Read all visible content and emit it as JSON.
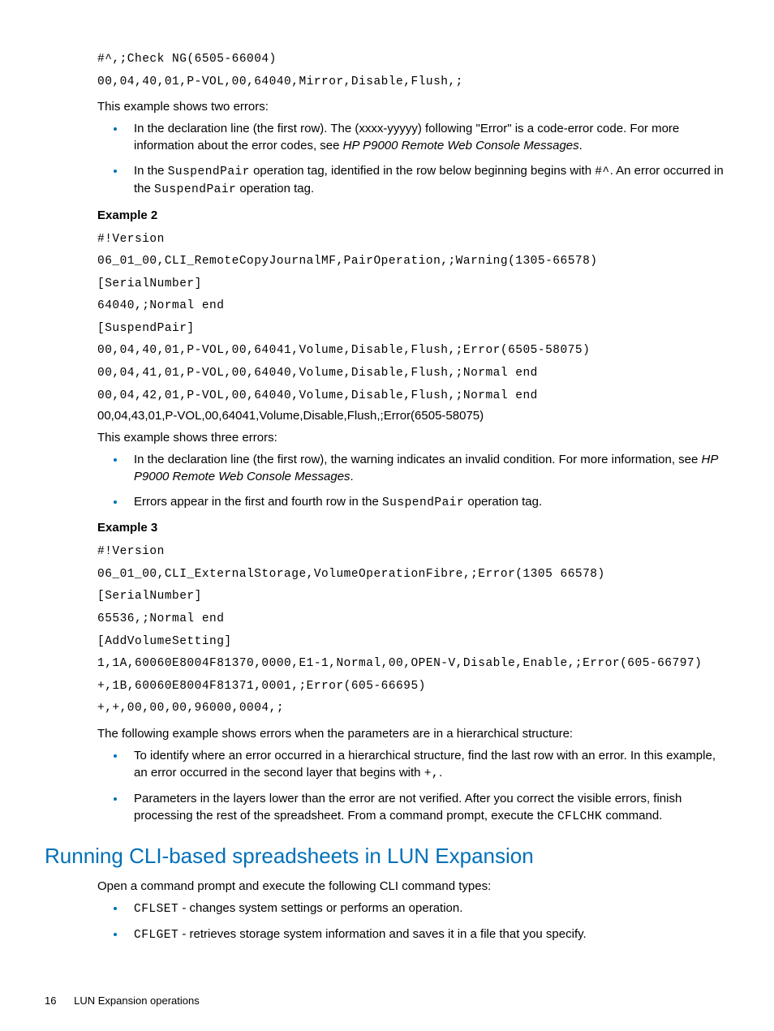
{
  "block1": {
    "lines": [
      "#^,;Check NG(6505-66004)",
      "00,04,40,01,P-VOL,00,64040,Mirror,Disable,Flush,;"
    ],
    "intro": "This example shows two errors:",
    "bullets": [
      {
        "pre": "In the declaration line (the first row). The (xxxx-yyyyy) following \"Error\" is a code-error code. For more information about the error codes, see ",
        "ital": "HP P9000 Remote Web Console Messages",
        "post": "."
      },
      {
        "pre1": "In the ",
        "code1": "SuspendPair",
        "mid1": " operation tag, identified in the row below beginning begins with ",
        "code2": "#^",
        "mid2": ". An error occurred in the ",
        "code3": "SuspendPair",
        "post": " operation tag."
      }
    ]
  },
  "example2": {
    "header": "Example 2",
    "lines": [
      "#!Version",
      "06_01_00,CLI_RemoteCopyJournalMF,PairOperation,;Warning(1305-66578)",
      "[SerialNumber]",
      "64040,;Normal end",
      "[SuspendPair]",
      "00,04,40,01,P-VOL,00,64041,Volume,Disable,Flush,;Error(6505-58075)",
      "00,04,41,01,P-VOL,00,64040,Volume,Disable,Flush,;Normal end",
      "00,04,42,01,P-VOL,00,64040,Volume,Disable,Flush,;Normal end"
    ],
    "sans_line": "00,04,43,01,P-VOL,00,64041,Volume,Disable,Flush,;Error(6505-58075)",
    "intro": "This example shows three errors:",
    "bullets": [
      {
        "pre": "In the declaration line (the first row), the warning indicates an invalid condition. For more information, see ",
        "ital": "HP P9000 Remote Web Console Messages",
        "post": "."
      },
      {
        "pre": "Errors appear in the first and fourth row in the ",
        "code": "SuspendPair",
        "post": " operation tag."
      }
    ]
  },
  "example3": {
    "header": "Example 3",
    "lines": [
      "#!Version",
      "06_01_00,CLI_ExternalStorage,VolumeOperationFibre,;Error(1305 66578)",
      "[SerialNumber]",
      "65536,;Normal end",
      "[AddVolumeSetting]",
      "1,1A,60060E8004F81370,0000,E1-1,Normal,00,OPEN-V,Disable,Enable,;Error(605-66797)",
      "+,1B,60060E8004F81371,0001,;Error(605-66695)",
      "+,+,00,00,00,96000,0004,;"
    ],
    "intro": "The following example shows errors when the parameters are in a hierarchical structure:",
    "bullets": [
      {
        "pre": "To identify where an error occurred in a hierarchical structure, find the last row with an error. In this example, an error occurred in the second layer that begins with ",
        "code": "+,",
        "post": "."
      },
      {
        "pre": "Parameters in the layers lower than the error are not verified. After you correct the visible errors, finish processing the rest of the spreadsheet. From a command prompt, execute the ",
        "code": "CFLCHK",
        "post": " command."
      }
    ]
  },
  "section": {
    "title": "Running CLI-based spreadsheets in LUN Expansion",
    "intro": "Open a command prompt and execute the following CLI command types:",
    "bullets": [
      {
        "code": "CFLSET",
        "text": " - changes system settings or performs an operation."
      },
      {
        "code": "CFLGET",
        "text": " - retrieves storage system information and saves it in a file that you specify."
      }
    ]
  },
  "footer": {
    "page": "16",
    "title": "LUN Expansion operations"
  }
}
